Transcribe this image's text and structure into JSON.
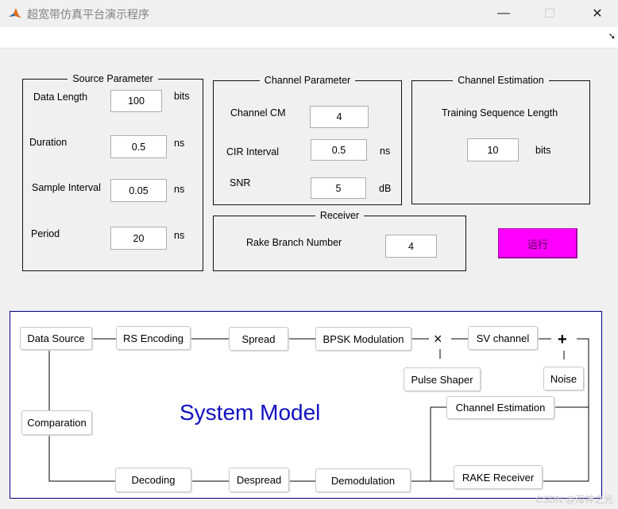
{
  "window": {
    "title": "超宽带仿真平台演示程序",
    "controls": {
      "minimize": "—",
      "maximize": "☐",
      "close": "✕"
    },
    "toolbar_arrow": "➘"
  },
  "source_parameter": {
    "title": "Source Parameter",
    "data_length": {
      "label": "Data Length",
      "value": "100",
      "unit": "bits"
    },
    "duration": {
      "label": "Duration",
      "value": "0.5",
      "unit": "ns"
    },
    "sample_interval": {
      "label": "Sample Interval",
      "value": "0.05",
      "unit": "ns"
    },
    "period": {
      "label": "Period",
      "value": "20",
      "unit": "ns"
    }
  },
  "channel_parameter": {
    "title": "Channel Parameter",
    "channel_cm": {
      "label": "Channel CM",
      "value": "4"
    },
    "cir_interval": {
      "label": "CIR Interval",
      "value": "0.5",
      "unit": "ns"
    },
    "snr": {
      "label": "SNR",
      "value": "5",
      "unit": "dB"
    }
  },
  "channel_estimation": {
    "title": "Channel Estimation",
    "training_length": {
      "label": "Training Sequence Length",
      "value": "10",
      "unit": "bits"
    }
  },
  "receiver": {
    "title": "Receiver",
    "rake_branch": {
      "label": "Rake Branch Number",
      "value": "4"
    }
  },
  "run_button": {
    "label": "运行",
    "color": "#ff00ff"
  },
  "system_model": {
    "title": "System Model",
    "blocks": {
      "data_source": "Data Source",
      "rs_encoding": "RS Encoding",
      "spread": "Spread",
      "bpsk_modulation": "BPSK Modulation",
      "sv_channel": "SV channel",
      "pulse_shaper": "Pulse Shaper",
      "noise": "Noise",
      "channel_estimation": "Channel Estimation",
      "comparation": "Comparation",
      "rake_receiver": "RAKE Receiver",
      "demodulation": "Demodulation",
      "despread": "Despread",
      "decoding": "Decoding"
    },
    "multiply_symbol": "×",
    "add_symbol": "+"
  },
  "watermark": "CSDN @海神之光"
}
